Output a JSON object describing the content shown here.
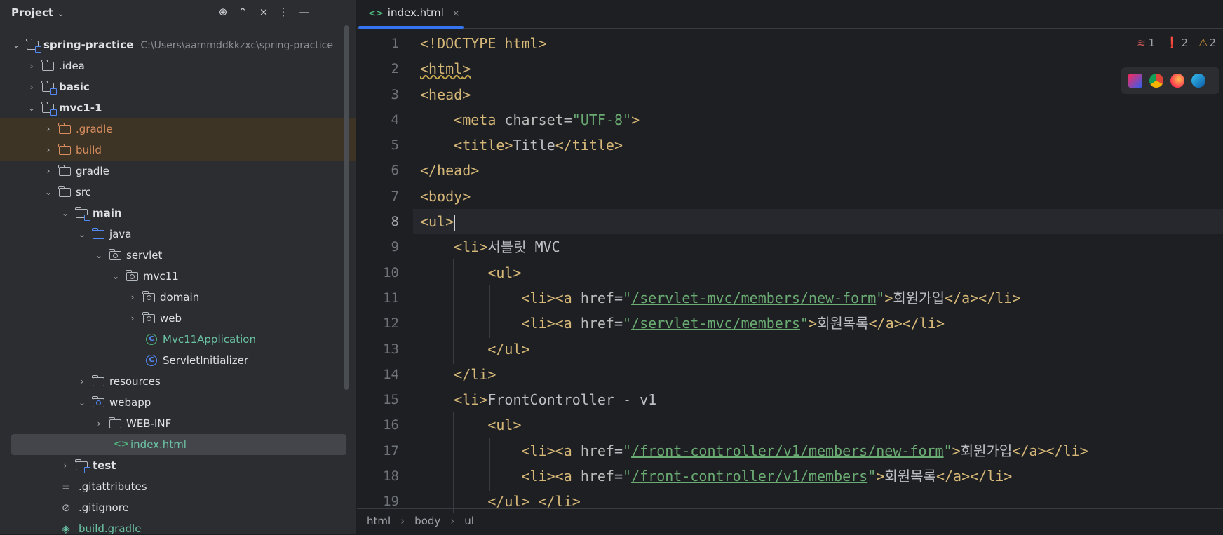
{
  "project_panel": {
    "title": "Project",
    "header_icons": [
      "locate-icon",
      "expand-all-icon",
      "collapse-all-icon",
      "options-icon",
      "hide-icon"
    ],
    "tree": [
      {
        "label": "spring-practice",
        "path": "C:\\Users\\aammddkkzxc\\spring-practice",
        "icon": "module-folder-icon",
        "expanded": true,
        "bold": true
      },
      {
        "label": ".idea",
        "icon": "folder-icon",
        "expanded": false
      },
      {
        "label": "basic",
        "icon": "module-folder-icon",
        "expanded": false,
        "bold": true
      },
      {
        "label": "mvc1-1",
        "icon": "module-folder-icon",
        "expanded": true,
        "bold": true
      },
      {
        "label": ".gradle",
        "icon": "excluded-folder-icon",
        "expanded": false
      },
      {
        "label": "build",
        "icon": "excluded-folder-icon",
        "expanded": false
      },
      {
        "label": "gradle",
        "icon": "folder-icon",
        "expanded": false
      },
      {
        "label": "src",
        "icon": "folder-icon",
        "expanded": true
      },
      {
        "label": "main",
        "icon": "module-folder-icon",
        "expanded": true,
        "bold": true
      },
      {
        "label": "java",
        "icon": "source-folder-icon",
        "expanded": true
      },
      {
        "label": "servlet",
        "icon": "package-icon",
        "expanded": true
      },
      {
        "label": "mvc11",
        "icon": "package-icon",
        "expanded": true
      },
      {
        "label": "domain",
        "icon": "package-icon",
        "expanded": false
      },
      {
        "label": "web",
        "icon": "package-icon",
        "expanded": false
      },
      {
        "label": "Mvc11Application",
        "icon": "spring-class-icon"
      },
      {
        "label": "ServletInitializer",
        "icon": "class-icon"
      },
      {
        "label": "resources",
        "icon": "resources-folder-icon",
        "expanded": false
      },
      {
        "label": "webapp",
        "icon": "web-folder-icon",
        "expanded": true
      },
      {
        "label": "WEB-INF",
        "icon": "folder-icon",
        "expanded": false
      },
      {
        "label": "index.html",
        "icon": "html-file-icon",
        "selected": true
      },
      {
        "label": "test",
        "icon": "module-folder-icon",
        "expanded": false,
        "bold": true
      },
      {
        "label": ".gitattributes",
        "icon": "text-file-icon"
      },
      {
        "label": ".gitignore",
        "icon": "ignore-file-icon"
      },
      {
        "label": "build.gradle",
        "icon": "gradle-file-icon"
      }
    ]
  },
  "editor": {
    "tab": {
      "label": "index.html",
      "icon": "html-file-icon",
      "close": "×"
    },
    "inspections": {
      "typo": "1",
      "errors": "2",
      "warnings": "2"
    },
    "browsers": [
      "intellij-icon",
      "chrome-icon",
      "firefox-icon",
      "edge-icon"
    ],
    "line_numbers": [
      "1",
      "2",
      "3",
      "4",
      "5",
      "6",
      "7",
      "8",
      "9",
      "10",
      "11",
      "12",
      "13",
      "14",
      "15",
      "16",
      "17",
      "18",
      "19"
    ],
    "current_line": "8",
    "lines": [
      "<!DOCTYPE html>",
      "<html>",
      "<head>",
      "    <meta charset=\"UTF-8\">",
      "    <title>Title</title>",
      "</head>",
      "<body>",
      "<ul>",
      "    <li>서블릿 MVC",
      "        <ul>",
      "            <li><a href=\"/servlet-mvc/members/new-form\">회원가입</a></li>",
      "            <li><a href=\"/servlet-mvc/members\">회원목록</a></li>",
      "        </ul>",
      "    </li>",
      "    <li>FrontController - v1",
      "        <ul>",
      "            <li><a href=\"/front-controller/v1/members/new-form\">회원가입</a></li>",
      "            <li><a href=\"/front-controller/v1/members\">회원목록</a></li>",
      "        </ul> </li>"
    ],
    "breadcrumb": [
      "html",
      "body",
      "ul"
    ]
  }
}
